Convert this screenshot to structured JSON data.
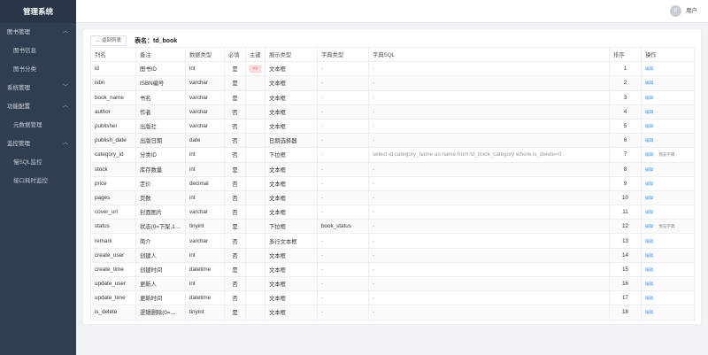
{
  "app": {
    "title": "管理系统"
  },
  "sidebar": {
    "groups": [
      {
        "label": "图书管理",
        "items": [
          "图书信息",
          "图书分类"
        ]
      },
      {
        "label": "系统管理",
        "items": []
      },
      {
        "label": "功能配置",
        "items": [
          "元数据管理"
        ]
      },
      {
        "label": "监控管理",
        "items": [
          "慢SQL监控",
          "接口耗时监控"
        ]
      }
    ]
  },
  "header": {
    "avatar_text": "U",
    "user_name": "用户"
  },
  "toolbar": {
    "back_label": "← 返回列表",
    "table_name": "表名：td_book"
  },
  "table": {
    "columns": [
      "列名",
      "备注",
      "数据类型",
      "必填",
      "主键",
      "展示类型",
      "字典类型",
      "字典SQL",
      "排序",
      "操作"
    ],
    "pk_tag": "PK",
    "edit_label": "编辑",
    "preview_label": "预览字典",
    "rows": [
      {
        "name": "id",
        "comment": "图书ID",
        "type": "int",
        "required": "是",
        "pk": true,
        "display": "文本框",
        "dict_type": "-",
        "dict_sql": "-",
        "order": "1",
        "preview": false
      },
      {
        "name": "isbn",
        "comment": "ISBN编号",
        "type": "varchar",
        "required": "是",
        "pk": false,
        "display": "文本框",
        "dict_type": "-",
        "dict_sql": "-",
        "order": "2",
        "preview": false
      },
      {
        "name": "book_name",
        "comment": "书名",
        "type": "varchar",
        "required": "是",
        "pk": false,
        "display": "文本框",
        "dict_type": "-",
        "dict_sql": "-",
        "order": "3",
        "preview": false
      },
      {
        "name": "author",
        "comment": "作者",
        "type": "varchar",
        "required": "否",
        "pk": false,
        "display": "文本框",
        "dict_type": "-",
        "dict_sql": "-",
        "order": "4",
        "preview": false
      },
      {
        "name": "publisher",
        "comment": "出版社",
        "type": "varchar",
        "required": "否",
        "pk": false,
        "display": "文本框",
        "dict_type": "-",
        "dict_sql": "-",
        "order": "5",
        "preview": false
      },
      {
        "name": "publish_date",
        "comment": "出版日期",
        "type": "date",
        "required": "否",
        "pk": false,
        "display": "日期选择器",
        "dict_type": "-",
        "dict_sql": "-",
        "order": "6",
        "preview": false
      },
      {
        "name": "category_id",
        "comment": "分类ID",
        "type": "int",
        "required": "否",
        "pk": false,
        "display": "下拉框",
        "dict_type": "-",
        "dict_sql": "select id,category_name as name from td_book_category where is_delete=0",
        "order": "7",
        "preview": true
      },
      {
        "name": "stock",
        "comment": "库存数量",
        "type": "int",
        "required": "是",
        "pk": false,
        "display": "文本框",
        "dict_type": "-",
        "dict_sql": "-",
        "order": "8",
        "preview": false
      },
      {
        "name": "price",
        "comment": "定价",
        "type": "decimal",
        "required": "否",
        "pk": false,
        "display": "文本框",
        "dict_type": "-",
        "dict_sql": "-",
        "order": "9",
        "preview": false
      },
      {
        "name": "pages",
        "comment": "页数",
        "type": "int",
        "required": "否",
        "pk": false,
        "display": "文本框",
        "dict_type": "-",
        "dict_sql": "-",
        "order": "10",
        "preview": false
      },
      {
        "name": "cover_url",
        "comment": "封面图片",
        "type": "varchar",
        "required": "否",
        "pk": false,
        "display": "文本框",
        "dict_type": "-",
        "dict_sql": "-",
        "order": "11",
        "preview": false
      },
      {
        "name": "status",
        "comment": "状态(0=下架,1=…",
        "type": "tinyint",
        "required": "是",
        "pk": false,
        "display": "下拉框",
        "dict_type": "book_status",
        "dict_sql": "-",
        "order": "12",
        "preview": true
      },
      {
        "name": "remark",
        "comment": "简介",
        "type": "varchar",
        "required": "否",
        "pk": false,
        "display": "多行文本框",
        "dict_type": "-",
        "dict_sql": "-",
        "order": "13",
        "preview": false
      },
      {
        "name": "create_user",
        "comment": "创建人",
        "type": "int",
        "required": "否",
        "pk": false,
        "display": "文本框",
        "dict_type": "-",
        "dict_sql": "-",
        "order": "14",
        "preview": false
      },
      {
        "name": "create_time",
        "comment": "创建时间",
        "type": "datetime",
        "required": "是",
        "pk": false,
        "display": "文本框",
        "dict_type": "-",
        "dict_sql": "-",
        "order": "15",
        "preview": false
      },
      {
        "name": "update_user",
        "comment": "更新人",
        "type": "int",
        "required": "否",
        "pk": false,
        "display": "文本框",
        "dict_type": "-",
        "dict_sql": "-",
        "order": "16",
        "preview": false
      },
      {
        "name": "update_time",
        "comment": "更新时间",
        "type": "datetime",
        "required": "否",
        "pk": false,
        "display": "文本框",
        "dict_type": "-",
        "dict_sql": "-",
        "order": "17",
        "preview": false
      },
      {
        "name": "is_delete",
        "comment": "逻辑删除(0=未删…",
        "type": "tinyint",
        "required": "是",
        "pk": false,
        "display": "文本框",
        "dict_type": "-",
        "dict_sql": "-",
        "order": "18",
        "preview": false
      }
    ]
  }
}
